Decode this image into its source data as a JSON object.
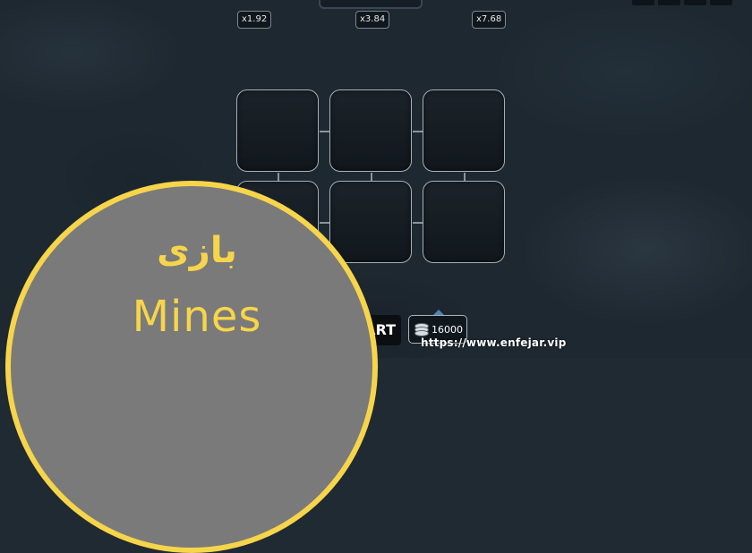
{
  "multipliers": [
    "x1.92",
    "x3.84",
    "x7.68"
  ],
  "tiles": [
    {
      "id": "tile-1"
    },
    {
      "id": "tile-2"
    },
    {
      "id": "tile-3"
    },
    {
      "id": "tile-4"
    },
    {
      "id": "tile-5"
    },
    {
      "id": "tile-6"
    }
  ],
  "controls": {
    "start_label": "ART",
    "balance": "16000",
    "balance_icon": "coins-icon"
  },
  "overlay": {
    "title_fa": "بازی",
    "title_en": "Mines",
    "url": "https://www.enfejar.vip"
  },
  "colors": {
    "badge_accent": "#f7d54a",
    "badge_fill": "#7a7a7a",
    "background": "#1f2a33"
  }
}
